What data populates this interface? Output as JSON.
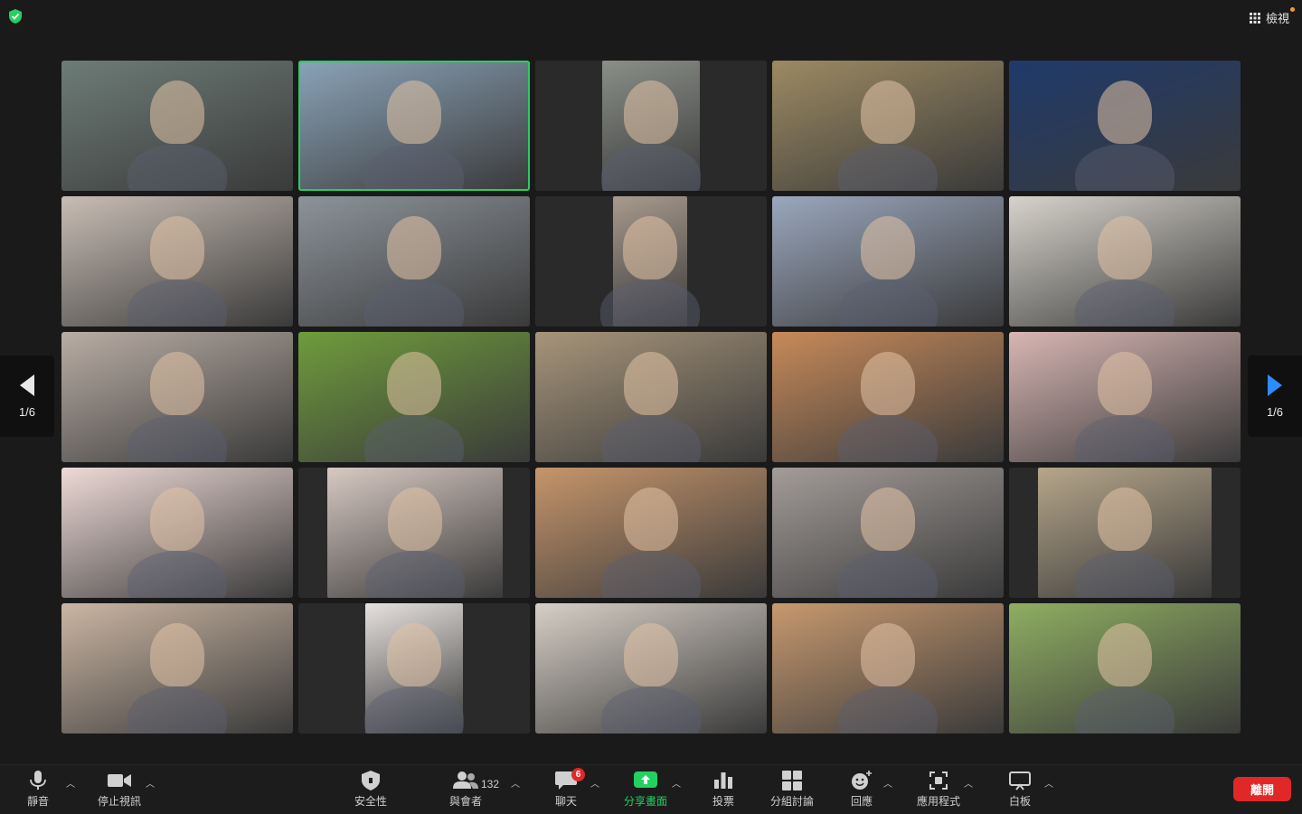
{
  "top_right": {
    "view_label": "檢視"
  },
  "pager": {
    "left_label": "1/6",
    "right_label": "1/6"
  },
  "tiles": [
    {
      "bg": "#6d7c77",
      "active": false
    },
    {
      "bg": "#8aa3b8",
      "active": true
    },
    {
      "bg": "#8a8f88",
      "active": false
    },
    {
      "bg": "#9c8a62",
      "active": false
    },
    {
      "bg": "#1f3a6b",
      "active": false
    },
    {
      "bg": "#c8bdb4",
      "active": false
    },
    {
      "bg": "#8c939a",
      "active": false
    },
    {
      "bg": "#a89a8d",
      "active": false
    },
    {
      "bg": "#9aa7bd",
      "active": false
    },
    {
      "bg": "#d7d3cb",
      "active": false
    },
    {
      "bg": "#b9ada4",
      "active": false
    },
    {
      "bg": "#6f9c3c",
      "active": false
    },
    {
      "bg": "#a7957a",
      "active": false
    },
    {
      "bg": "#c78a5a",
      "active": false
    },
    {
      "bg": "#d8b6b3",
      "active": false
    },
    {
      "bg": "#eedad6",
      "active": false
    },
    {
      "bg": "#d7c9c2",
      "active": false
    },
    {
      "bg": "#c6956b",
      "active": false
    },
    {
      "bg": "#a39c99",
      "active": false
    },
    {
      "bg": "#b6a68a",
      "active": false
    },
    {
      "bg": "#cbb6a3",
      "active": false
    },
    {
      "bg": "#e6e1de",
      "active": false
    },
    {
      "bg": "#d7cfc6",
      "active": false
    },
    {
      "bg": "#c7996f",
      "active": false
    },
    {
      "bg": "#8fae62",
      "active": false
    }
  ],
  "toolbar": {
    "mute": "靜音",
    "stop_video": "停止視訊",
    "security": "安全性",
    "participants": "與會者",
    "participants_count": "132",
    "chat": "聊天",
    "chat_badge": "6",
    "share": "分享畫面",
    "polls": "投票",
    "breakout": "分組討論",
    "reactions": "回應",
    "apps": "應用程式",
    "whiteboard": "白板",
    "leave": "離開"
  },
  "colors": {
    "accent_green": "#23d160",
    "leave_red": "#e02828"
  }
}
